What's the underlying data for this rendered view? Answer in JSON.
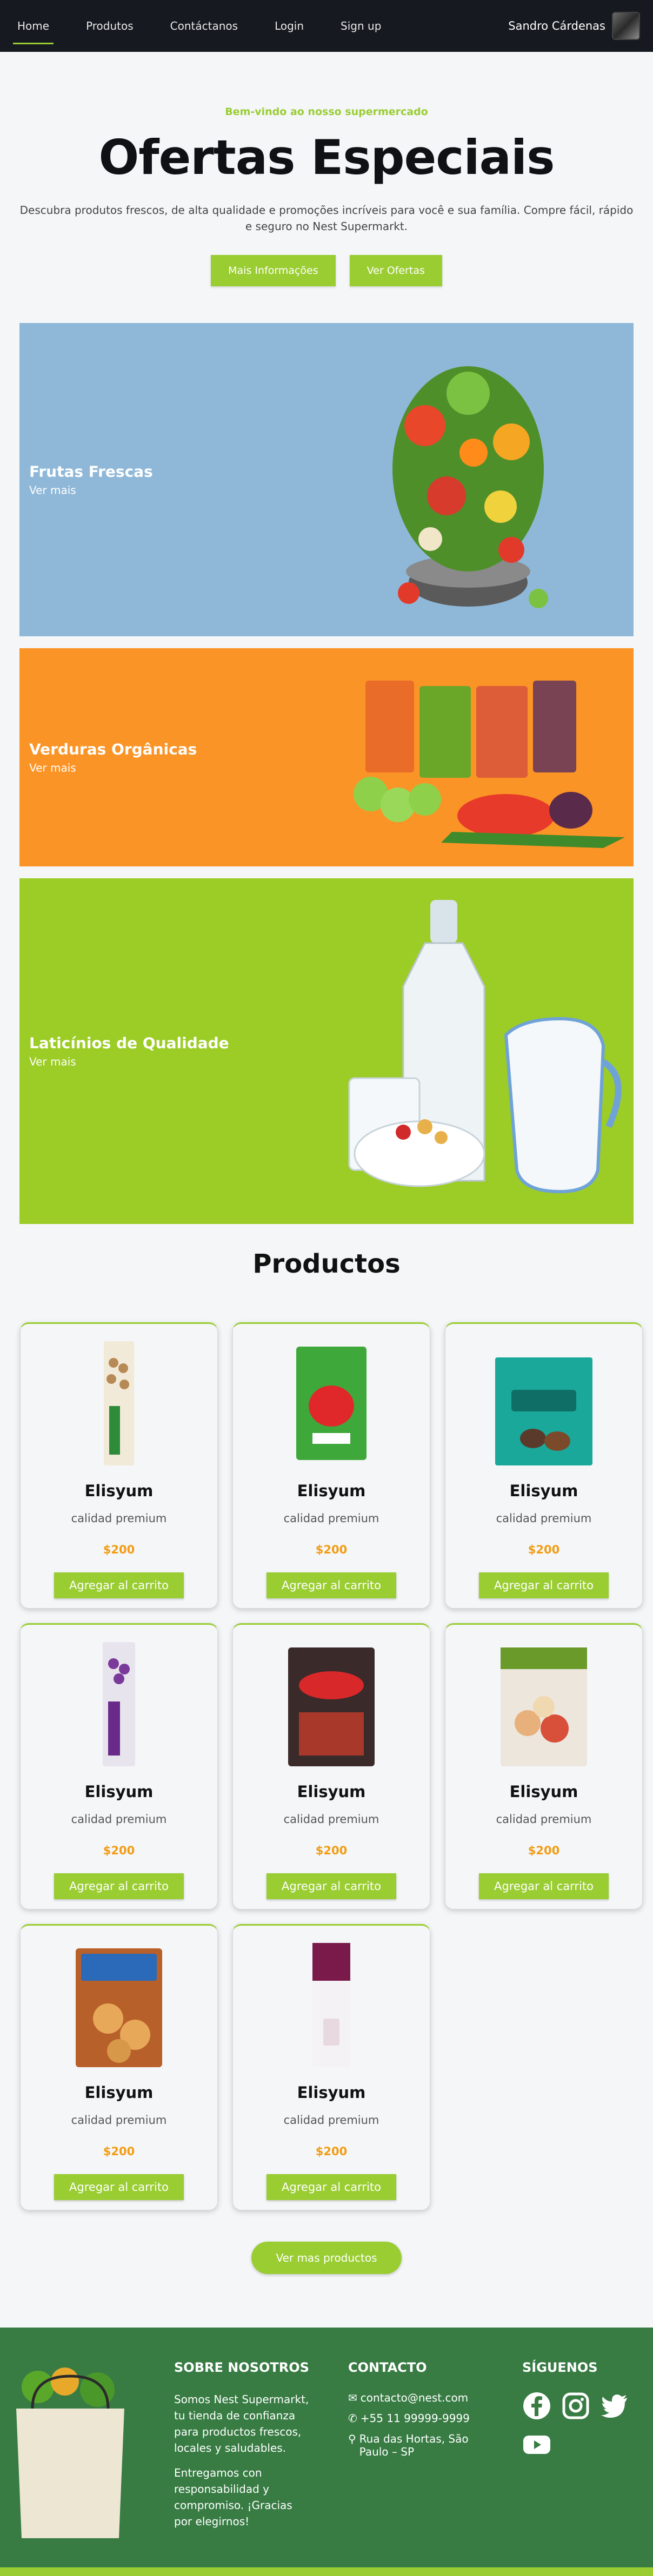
{
  "nav": {
    "links": [
      "Home",
      "Produtos",
      "Contáctanos",
      "Login",
      "Sign up"
    ],
    "user_name": "Sandro Cárdenas"
  },
  "hero": {
    "kicker": "Bem-vindo ao nosso supermercado",
    "title": "Ofertas Especiais",
    "description": "Descubra produtos frescos, de alta qualidade e promoções incríveis para você e sua família. Compre fácil, rápido e seguro no Nest Supermarkt.",
    "btn_info": "Mais Informações",
    "btn_offers": "Ver Ofertas"
  },
  "banners": [
    {
      "title": "Frutas Frescas",
      "link": "Ver mais",
      "color": "#8fb8d8"
    },
    {
      "title": "Verduras Orgânicas",
      "link": "Ver mais",
      "color": "#fb9426"
    },
    {
      "title": "Laticínios de Qualidade",
      "link": "Ver mais",
      "color": "#9ccc26"
    }
  ],
  "products": {
    "title": "Productos",
    "items": [
      {
        "name": "Elisyum",
        "desc": "calidad premium",
        "price": "$200",
        "button": "Agregar al carrito",
        "icon": "ades-almond-carton"
      },
      {
        "name": "Elisyum",
        "desc": "calidad premium",
        "price": "$200",
        "button": "Agregar al carrito",
        "icon": "strawberry-jelly-pack"
      },
      {
        "name": "Elisyum",
        "desc": "calidad premium",
        "price": "$200",
        "button": "Agregar al carrito",
        "icon": "larin-chocolate-box"
      },
      {
        "name": "Elisyum",
        "desc": "calidad premium",
        "price": "$200",
        "button": "Agregar al carrito",
        "icon": "ades-soy-grape-carton"
      },
      {
        "name": "Elisyum",
        "desc": "calidad premium",
        "price": "$200",
        "button": "Agregar al carrito",
        "icon": "gansito-candy-bag"
      },
      {
        "name": "Elisyum",
        "desc": "calidad premium",
        "price": "$200",
        "button": "Agregar al carrito",
        "icon": "veggie-chips-bag"
      },
      {
        "name": "Elisyum",
        "desc": "calidad premium",
        "price": "$200",
        "button": "Agregar al carrito",
        "icon": "gamesa-cookies-box"
      },
      {
        "name": "Elisyum",
        "desc": "calidad premium",
        "price": "$200",
        "button": "Agregar al carrito",
        "icon": "santa-clara-milk-carton"
      }
    ],
    "more_button": "Ver mas productos"
  },
  "footer": {
    "about_title": "SOBRE NOSOTROS",
    "about_text_1": "Somos Nest Supermarkt, tu tienda de confianza para productos frescos, locales y saludables.",
    "about_text_2": "Entregamos con responsabilidad y compromiso. ¡Gracias por elegirnos!",
    "contact_title": "CONTACTO",
    "email": "contacto@nest.com",
    "phone": "+55 11 99999-9999",
    "address": "Rua das Hortas, São Paulo – SP",
    "social_title": "SÍGUENOS",
    "socials": [
      "facebook-icon",
      "instagram-icon",
      "twitter-icon",
      "youtube-icon"
    ]
  },
  "colors": {
    "accent": "#9acd32",
    "price": "#f39c12",
    "nav_bg": "#161a20",
    "footer_bg": "#387c44"
  }
}
